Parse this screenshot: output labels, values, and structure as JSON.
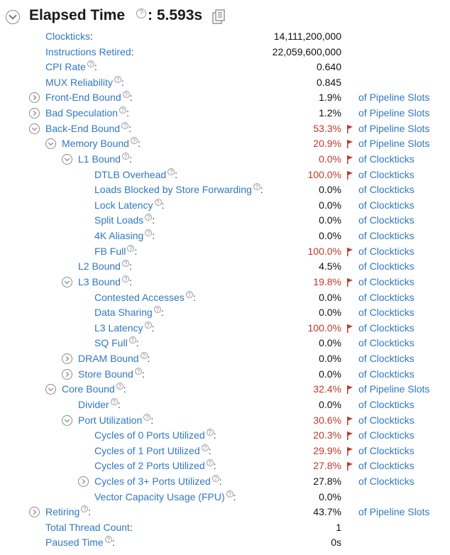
{
  "header": {
    "title": "Elapsed Time",
    "colon_value": ": 5.593s",
    "help_glyph": "?"
  },
  "colors": {
    "link": "#2f78c0",
    "hot": "#c0392b",
    "flag": "#c0392b"
  },
  "rows": [
    {
      "label": "Clockticks",
      "value": "14,111,200,000",
      "unit": "",
      "indent": 0,
      "toggle": "none",
      "hot": false,
      "help": false
    },
    {
      "label": "Instructions Retired",
      "value": "22,059,600,000",
      "unit": "",
      "indent": 0,
      "toggle": "none",
      "hot": false,
      "help": false
    },
    {
      "label": "CPI Rate",
      "value": "0.640",
      "unit": "",
      "indent": 0,
      "toggle": "none",
      "hot": false,
      "help": true
    },
    {
      "label": "MUX Reliability",
      "value": "0.845",
      "unit": "",
      "indent": 0,
      "toggle": "none",
      "hot": false,
      "help": true
    },
    {
      "label": "Front-End Bound",
      "value": "1.9%",
      "unit": "of Pipeline Slots",
      "indent": 0,
      "toggle": "right",
      "hot": false,
      "help": true
    },
    {
      "label": "Bad Speculation",
      "value": "1.2%",
      "unit": "of Pipeline Slots",
      "indent": 0,
      "toggle": "right",
      "hot": false,
      "help": true
    },
    {
      "label": "Back-End Bound",
      "value": "53.3%",
      "unit": "of Pipeline Slots",
      "indent": 0,
      "toggle": "down",
      "hot": true,
      "help": true
    },
    {
      "label": "Memory Bound",
      "value": "20.9%",
      "unit": "of Pipeline Slots",
      "indent": 1,
      "toggle": "down",
      "hot": true,
      "help": true
    },
    {
      "label": "L1 Bound",
      "value": "0.0%",
      "unit": "of Clockticks",
      "indent": 2,
      "toggle": "down",
      "hot": true,
      "help": true
    },
    {
      "label": "DTLB Overhead",
      "value": "100.0%",
      "unit": "of Clockticks",
      "indent": 3,
      "toggle": "none",
      "hot": true,
      "help": true
    },
    {
      "label": "Loads Blocked by Store Forwarding",
      "value": "0.0%",
      "unit": "of Clockticks",
      "indent": 3,
      "toggle": "none",
      "hot": false,
      "help": true
    },
    {
      "label": "Lock Latency",
      "value": "0.0%",
      "unit": "of Clockticks",
      "indent": 3,
      "toggle": "none",
      "hot": false,
      "help": true
    },
    {
      "label": "Split Loads",
      "value": "0.0%",
      "unit": "of Clockticks",
      "indent": 3,
      "toggle": "none",
      "hot": false,
      "help": true
    },
    {
      "label": "4K Aliasing",
      "value": "0.0%",
      "unit": "of Clockticks",
      "indent": 3,
      "toggle": "none",
      "hot": false,
      "help": true
    },
    {
      "label": "FB Full",
      "value": "100.0%",
      "unit": "of Clockticks",
      "indent": 3,
      "toggle": "none",
      "hot": true,
      "help": true
    },
    {
      "label": "L2 Bound",
      "value": "4.5%",
      "unit": "of Clockticks",
      "indent": 2,
      "toggle": "none",
      "hot": false,
      "help": true
    },
    {
      "label": "L3 Bound",
      "value": "19.8%",
      "unit": "of Clockticks",
      "indent": 2,
      "toggle": "down",
      "hot": true,
      "help": true
    },
    {
      "label": "Contested Accesses",
      "value": "0.0%",
      "unit": "of Clockticks",
      "indent": 3,
      "toggle": "none",
      "hot": false,
      "help": true
    },
    {
      "label": "Data Sharing",
      "value": "0.0%",
      "unit": "of Clockticks",
      "indent": 3,
      "toggle": "none",
      "hot": false,
      "help": true
    },
    {
      "label": "L3 Latency",
      "value": "100.0%",
      "unit": "of Clockticks",
      "indent": 3,
      "toggle": "none",
      "hot": true,
      "help": true
    },
    {
      "label": "SQ Full",
      "value": "0.0%",
      "unit": "of Clockticks",
      "indent": 3,
      "toggle": "none",
      "hot": false,
      "help": true
    },
    {
      "label": "DRAM Bound",
      "value": "0.0%",
      "unit": "of Clockticks",
      "indent": 2,
      "toggle": "right",
      "hot": false,
      "help": true
    },
    {
      "label": "Store Bound",
      "value": "0.0%",
      "unit": "of Clockticks",
      "indent": 2,
      "toggle": "right",
      "hot": false,
      "help": true
    },
    {
      "label": "Core Bound",
      "value": "32.4%",
      "unit": "of Pipeline Slots",
      "indent": 1,
      "toggle": "down",
      "hot": true,
      "help": true
    },
    {
      "label": "Divider",
      "value": "0.0%",
      "unit": "of Clockticks",
      "indent": 2,
      "toggle": "none",
      "hot": false,
      "help": true
    },
    {
      "label": "Port Utilization",
      "value": "30.6%",
      "unit": "of Clockticks",
      "indent": 2,
      "toggle": "down",
      "hot": true,
      "help": true
    },
    {
      "label": "Cycles of 0 Ports Utilized",
      "value": "20.3%",
      "unit": "of Clockticks",
      "indent": 3,
      "toggle": "none",
      "hot": true,
      "help": true
    },
    {
      "label": "Cycles of 1 Port Utilized",
      "value": "29.9%",
      "unit": "of Clockticks",
      "indent": 3,
      "toggle": "none",
      "hot": true,
      "help": true
    },
    {
      "label": "Cycles of 2 Ports Utilized",
      "value": "27.8%",
      "unit": "of Clockticks",
      "indent": 3,
      "toggle": "none",
      "hot": true,
      "help": true
    },
    {
      "label": "Cycles of 3+ Ports Utilized",
      "value": "27.8%",
      "unit": "of Clockticks",
      "indent": 3,
      "toggle": "right",
      "hot": false,
      "help": true
    },
    {
      "label": "Vector Capacity Usage (FPU)",
      "value": "0.0%",
      "unit": "",
      "indent": 3,
      "toggle": "none",
      "hot": false,
      "help": true
    },
    {
      "label": "Retiring",
      "value": "43.7%",
      "unit": "of Pipeline Slots",
      "indent": 0,
      "toggle": "right",
      "hot": false,
      "help": true
    },
    {
      "label": "Total Thread Count",
      "value": "1",
      "unit": "",
      "indent": 0,
      "toggle": "none",
      "hot": false,
      "help": false
    },
    {
      "label": "Paused Time",
      "value": "0s",
      "unit": "",
      "indent": 0,
      "toggle": "none",
      "hot": false,
      "help": true
    }
  ]
}
